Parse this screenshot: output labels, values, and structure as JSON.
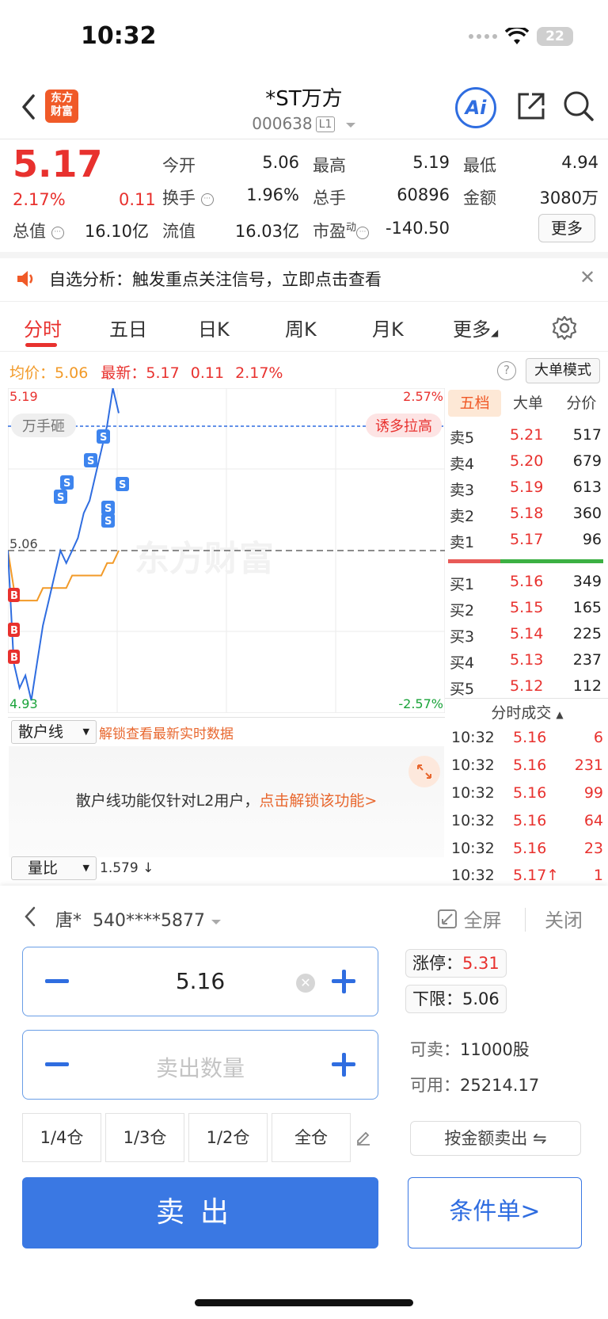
{
  "status_bar": {
    "time": "10:32",
    "battery": "22"
  },
  "header": {
    "logo_text_1": "东方",
    "logo_text_2": "财富",
    "title": "*ST万方",
    "code": "000638",
    "level_badge": "L1",
    "ai_label": "Ai"
  },
  "quote": {
    "price": "5.17",
    "pct": "2.17%",
    "change": "0.11",
    "labels": {
      "open": "今开",
      "high": "最高",
      "low": "最低",
      "turnover": "换手",
      "volume": "总手",
      "amount": "金额",
      "total_value": "总值",
      "float_value": "流值",
      "pe": "市盈",
      "pe_sup": "动"
    },
    "values": {
      "open": "5.06",
      "high": "5.19",
      "low": "4.94",
      "turnover": "1.96%",
      "volume": "60896",
      "amount": "3080万",
      "total_value": "16.10亿",
      "float_value": "16.03亿",
      "pe": "-140.50"
    },
    "more_label": "更多"
  },
  "banner": {
    "text": "自选分析：触发重点关注信号，立即点击查看"
  },
  "tabs": [
    "分时",
    "五日",
    "日K",
    "周K",
    "月K",
    "更多"
  ],
  "chart_header": {
    "avg_label": "均价：",
    "avg_value": "5.06",
    "latest_label": "最新：",
    "latest_value": "5.17",
    "latest_change": "0.11",
    "latest_pct": "2.17%",
    "help": "?",
    "big_mode": "大单模式"
  },
  "chart_data": {
    "type": "line",
    "title": "",
    "y_high": "5.19",
    "y_low": "4.93",
    "y_mid": "5.06",
    "pct_high": "2.57%",
    "pct_low": "-2.57%",
    "ylim": [
      4.93,
      5.19
    ],
    "watermark": "东方财富",
    "tags": {
      "left": "万手砸",
      "right": "诱多拉高"
    },
    "series": [
      {
        "name": "",
        "color": "#2f6de0",
        "values": [
          5.06,
          4.97,
          4.95,
          4.96,
          4.94,
          4.97,
          5.0,
          5.02,
          5.04,
          5.06,
          5.05,
          5.06,
          5.07,
          5.09,
          5.1,
          5.12,
          5.14,
          5.16,
          5.19,
          5.17
        ]
      },
      {
        "name": "",
        "color": "#f29a28",
        "values": [
          5.06,
          5.03,
          5.02,
          5.02,
          5.02,
          5.02,
          5.03,
          5.03,
          5.03,
          5.03,
          5.03,
          5.04,
          5.04,
          5.04,
          5.04,
          5.04,
          5.04,
          5.05,
          5.05,
          5.06
        ]
      }
    ]
  },
  "order_book": {
    "tabs": [
      "五档",
      "大单",
      "分价"
    ],
    "asks": [
      {
        "label": "卖5",
        "price": "5.21",
        "vol": "517"
      },
      {
        "label": "卖4",
        "price": "5.20",
        "vol": "679"
      },
      {
        "label": "卖3",
        "price": "5.19",
        "vol": "613"
      },
      {
        "label": "卖2",
        "price": "5.18",
        "vol": "360"
      },
      {
        "label": "卖1",
        "price": "5.17",
        "vol": "96"
      }
    ],
    "bids": [
      {
        "label": "买1",
        "price": "5.16",
        "vol": "349"
      },
      {
        "label": "买2",
        "price": "5.15",
        "vol": "165"
      },
      {
        "label": "买3",
        "price": "5.14",
        "vol": "225"
      },
      {
        "label": "买4",
        "price": "5.13",
        "vol": "237"
      },
      {
        "label": "买5",
        "price": "5.12",
        "vol": "112"
      }
    ],
    "trades_title": "分时成交",
    "trades": [
      {
        "time": "10:32",
        "price": "5.16",
        "vol": "6"
      },
      {
        "time": "10:32",
        "price": "5.16",
        "vol": "231"
      },
      {
        "time": "10:32",
        "price": "5.16",
        "vol": "99"
      },
      {
        "time": "10:32",
        "price": "5.16",
        "vol": "64"
      },
      {
        "time": "10:32",
        "price": "5.16",
        "vol": "23"
      },
      {
        "time": "10:32",
        "price": "5.17↑",
        "vol": "1"
      }
    ]
  },
  "indicator": {
    "retail_select": "散户线",
    "unlock_link": "解锁查看最新实时数据",
    "retail_msg": "散户线功能仅针对L2用户，",
    "retail_msg_link": "点击解锁该功能>",
    "vol_ratio_select": "量比",
    "vol_ratio_value": "1.579 ↓"
  },
  "trade": {
    "account_name": "唐*",
    "account_no": "540****5877",
    "fullscreen": "全屏",
    "close": "关闭",
    "price_value": "5.16",
    "qty_placeholder": "卖出数量",
    "limit_up_label": "涨停：",
    "limit_up_value": "5.31",
    "limit_down_label": "下限：",
    "limit_down_value": "5.06",
    "sellable_label": "可卖：",
    "sellable_value": "11000股",
    "available_label": "可用：",
    "available_value": "25214.17",
    "positions": [
      "1/4仓",
      "1/3仓",
      "1/2仓",
      "全仓"
    ],
    "amount_sell": "按金额卖出 ⇋",
    "sell": "卖出",
    "conditional": "条件单>"
  }
}
